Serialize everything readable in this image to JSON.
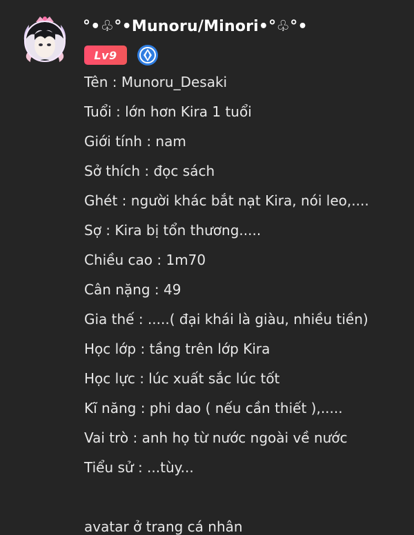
{
  "post": {
    "username": "°•♧°•Munoru/Minori•°♧°•",
    "level_badge": "Lv9",
    "avatar_icon": "anime-avatar-with-frame-icon",
    "title_icon": "diamond-title-icon",
    "colors": {
      "background": "#252525",
      "text": "#e8e8e8",
      "level_badge": "#ff4f6d",
      "title_icon": "#2f7de1"
    },
    "lines": [
      "Tên : Munoru_Desaki",
      "Tuổi : lớn hơn Kira 1 tuổi",
      "Giới tính : nam",
      "Sở thích : đọc sách",
      "Ghét : người khác bắt nạt Kira, nói leo,....",
      "Sợ : Kira bị tổn thương.....",
      "Chiều cao : 1m70",
      "Cân nặng : 49",
      "Gia thế : .....( đại khái là giàu, nhiều tiền)",
      "Học lớp : tầng trên lớp Kira",
      "Học lực : lúc xuất sắc lúc tốt",
      "Kĩ năng : phi dao ( nếu cần thiết ),.....",
      "Vai trò : anh họ từ nước ngoài về nước",
      "Tiểu sử : ...tùy..."
    ],
    "footer": "avatar ở trang cá nhân"
  }
}
